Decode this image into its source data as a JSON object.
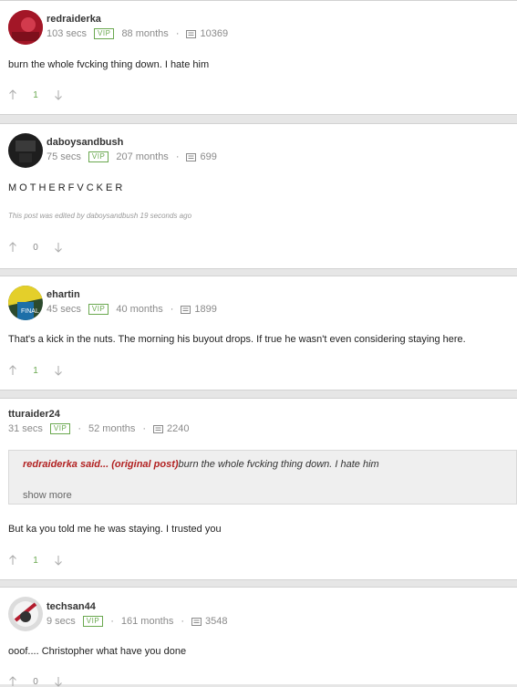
{
  "posts": [
    {
      "username": "redraiderka",
      "secs": "103 secs",
      "vip": "VIP",
      "months": "88 months",
      "post_count": "10369",
      "text": "burn the whole fvcking thing down. I hate him",
      "votes": "1"
    },
    {
      "username": "daboysandbush",
      "secs": "75 secs",
      "vip": "VIP",
      "months": "207 months",
      "post_count": "699",
      "text": "MOTHERFVCKER",
      "edited": "This post was edited by daboysandbush 19 seconds ago",
      "votes": "0"
    },
    {
      "username": "ehartin",
      "secs": "45 secs",
      "vip": "VIP",
      "months": "40 months",
      "post_count": "1899",
      "text": "That's a kick in the nuts. The morning his buyout drops. If true he wasn't even considering staying here.",
      "votes": "1"
    },
    {
      "username": "tturaider24",
      "secs": "31 secs",
      "vip": "VIP",
      "months": "52 months",
      "post_count": "2240",
      "quote_author": "redraiderka said... (original post)",
      "quote_text": "burn the whole fvcking thing down. I hate him",
      "show_more": "show more",
      "text": "But ka you told me he was staying. I trusted you",
      "votes": "1"
    },
    {
      "username": "techsan44",
      "secs": "9 secs",
      "vip": "VIP",
      "months": "161 months",
      "post_count": "3548",
      "text": "ooof.... Christopher what have you done",
      "votes": "0"
    }
  ],
  "colors": {
    "vip_green": "#6aa84f",
    "quote_author_red": "#b22222",
    "page_bg": "#e6e6e6"
  },
  "icons": [
    "upvote-arrow-icon",
    "downvote-arrow-icon",
    "message-icon"
  ]
}
